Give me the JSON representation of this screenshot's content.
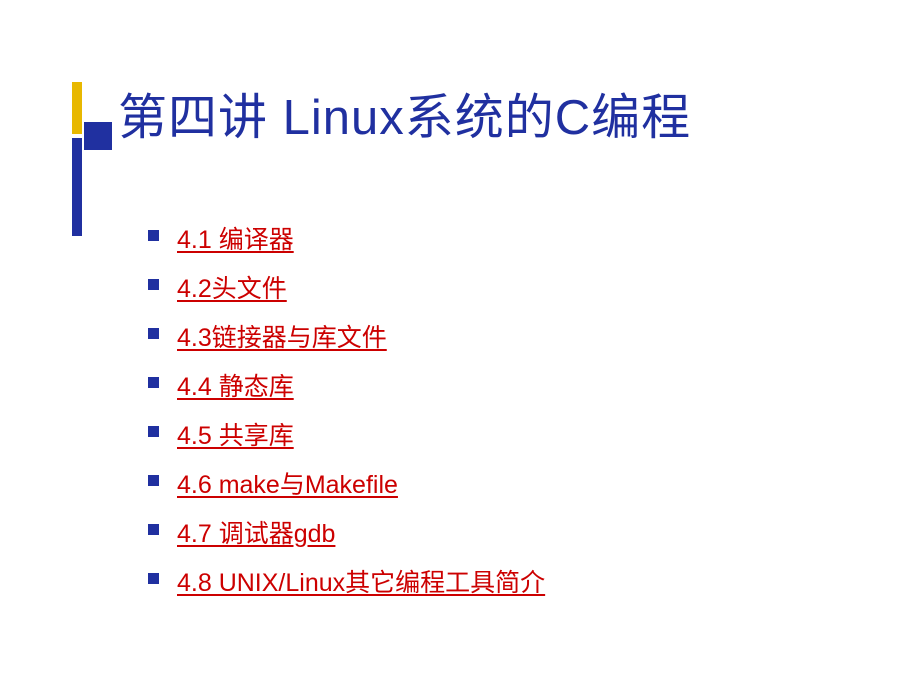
{
  "title": "第四讲 Linux系统的C编程",
  "toc": [
    {
      "label": "4.1 编译器"
    },
    {
      "label": "4.2头文件"
    },
    {
      "label": "4.3链接器与库文件"
    },
    {
      "label": "4.4 静态库"
    },
    {
      "label": "4.5 共享库"
    },
    {
      "label": "4.6 make与Makefile"
    },
    {
      "label": "4.7 调试器gdb"
    },
    {
      "label": "4.8 UNIX/Linux其它编程工具简介"
    }
  ]
}
